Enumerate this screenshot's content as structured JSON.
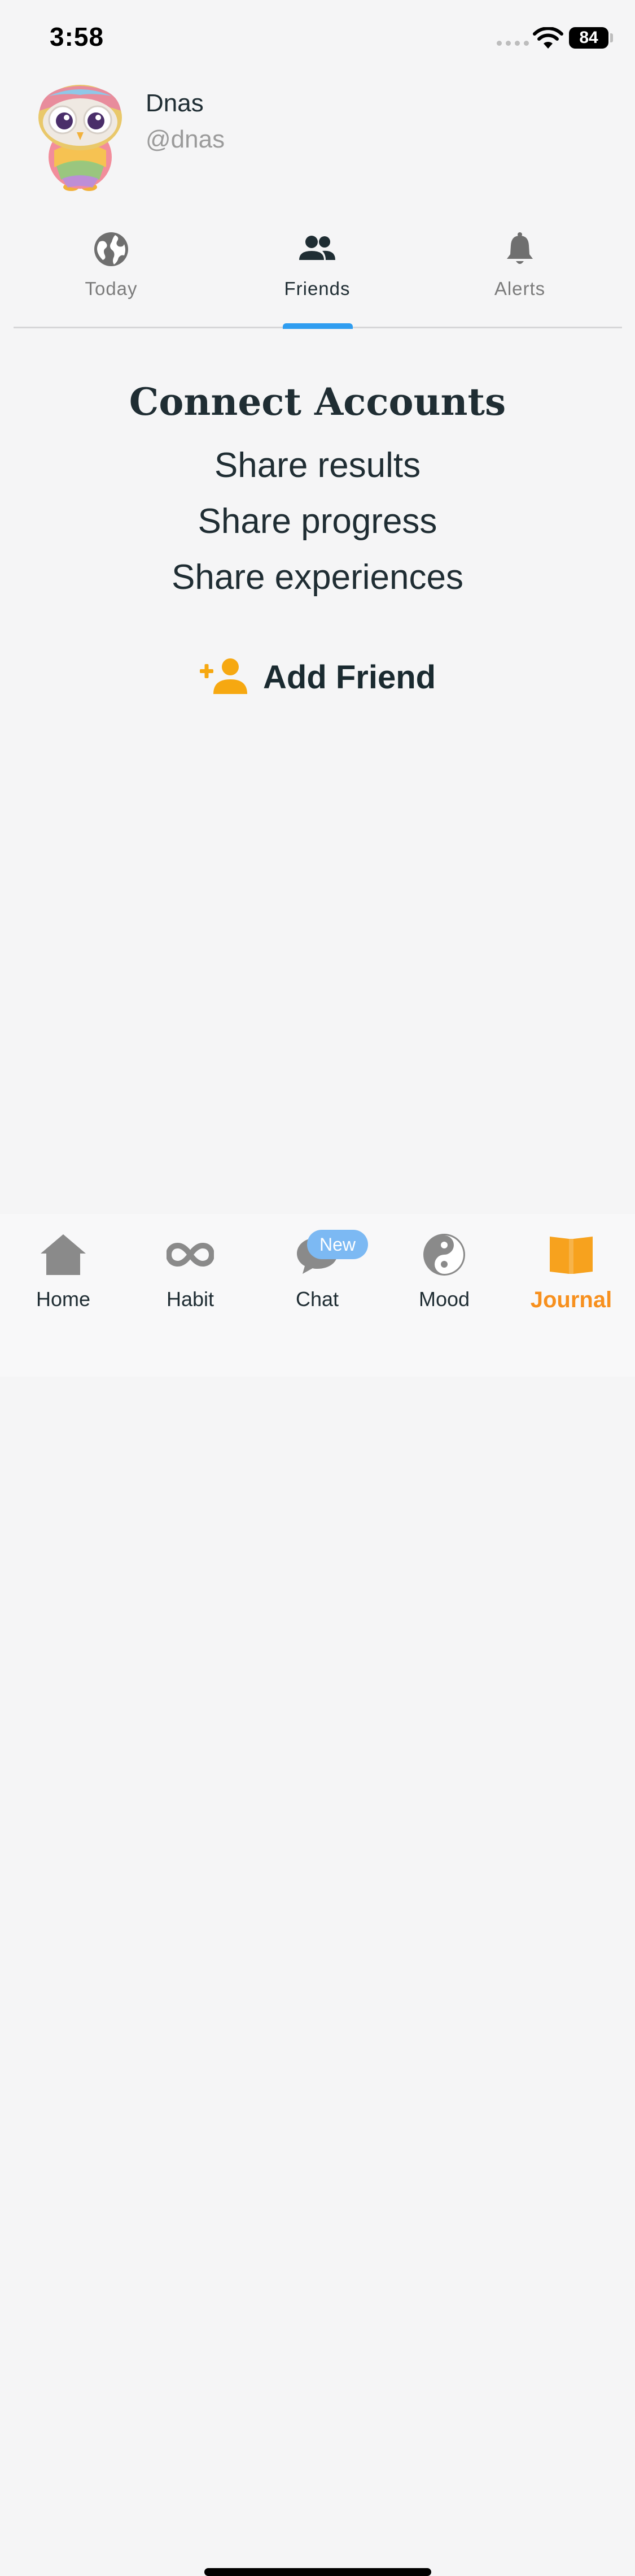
{
  "status_bar": {
    "time": "3:58",
    "battery": "84"
  },
  "profile": {
    "name": "Dnas",
    "handle": "@dnas",
    "avatar_icon": "owl-avatar-icon"
  },
  "tabs": [
    {
      "label": "Today",
      "icon": "globe-icon",
      "active": false
    },
    {
      "label": "Friends",
      "icon": "people-icon",
      "active": true
    },
    {
      "label": "Alerts",
      "icon": "bell-icon",
      "active": false
    }
  ],
  "connect": {
    "title": "Connect Accounts",
    "lines": [
      "Share results",
      "Share progress",
      "Share experiences"
    ],
    "add_friend_label": "Add Friend"
  },
  "bottom_nav": [
    {
      "label": "Home",
      "icon": "home-icon",
      "active": false
    },
    {
      "label": "Habit",
      "icon": "infinity-icon",
      "active": false
    },
    {
      "label": "Chat",
      "icon": "chat-bubble-icon",
      "active": false,
      "badge": "New"
    },
    {
      "label": "Mood",
      "icon": "yin-yang-icon",
      "active": false
    },
    {
      "label": "Journal",
      "icon": "open-book-icon",
      "active": true
    }
  ],
  "colors": {
    "accent_blue": "#2f9df0",
    "accent_orange": "#f7901e",
    "add_friend_icon": "#f6a811",
    "background": "#f5f5f6",
    "text_dark": "#1f2d33",
    "text_muted": "#9b9b9b"
  }
}
